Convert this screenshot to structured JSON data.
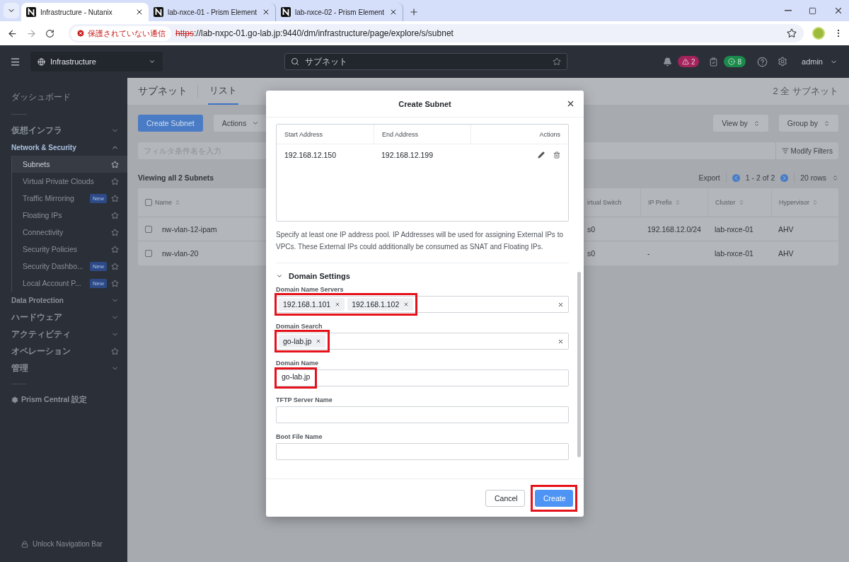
{
  "browser": {
    "tabs": [
      {
        "title": "Infrastructure - Nutanix",
        "selected": true
      },
      {
        "title": "lab-nxce-01 - Prism Element",
        "selected": false
      },
      {
        "title": "lab-nxce-02 - Prism Element",
        "selected": false
      }
    ],
    "security_label": "保護されていない通信",
    "url_scheme": "https",
    "url_rest": "://lab-nxpc-01.go-lab.jp:9440/dm/infrastructure/page/explore/s/subnet"
  },
  "header": {
    "app": "Infrastructure",
    "search": "サブネット",
    "alerts": "2",
    "tasks": "8",
    "user": "admin"
  },
  "sidebar": {
    "home": "ダッシュボード",
    "items": [
      {
        "label": "仮想インフラ",
        "kind": "group",
        "expanded": false
      },
      {
        "label": "Network & Security",
        "kind": "group",
        "expanded": true,
        "children": [
          {
            "label": "Subnets",
            "selected": true
          },
          {
            "label": "Virtual Private Clouds",
            "selected": false
          },
          {
            "label": "Traffic Mirroring",
            "badge": "New",
            "selected": false
          },
          {
            "label": "Floating IPs",
            "selected": false
          },
          {
            "label": "Connectivity",
            "selected": false
          },
          {
            "label": "Security Policies",
            "selected": false
          },
          {
            "label": "Security Dashbo...",
            "badge": "New",
            "selected": false
          },
          {
            "label": "Local Account P...",
            "badge": "New",
            "selected": false
          }
        ]
      },
      {
        "label": "Data Protection",
        "kind": "group",
        "expanded": false
      },
      {
        "label": "ハードウェア",
        "kind": "group",
        "expanded": false
      },
      {
        "label": "アクティビティ",
        "kind": "group",
        "expanded": false
      },
      {
        "label": "オペレーション",
        "kind": "favorite"
      },
      {
        "label": "管理",
        "kind": "group",
        "expanded": false
      }
    ],
    "settings": "Prism Central 設定",
    "unlock": "Unlock Navigation Bar"
  },
  "content": {
    "title": "サブネット",
    "tabs": [
      {
        "label": "リスト",
        "selected": true
      }
    ],
    "summary": "2 全 サブネット",
    "actions": [
      {
        "label": "Create Subnet",
        "kind": "primary"
      },
      {
        "label": "Actions",
        "kind": "menu"
      }
    ],
    "view_buttons": [
      "View by",
      "Group by"
    ],
    "filter": {
      "placeholder": "フィルタ条件名を入力",
      "action": "Modify Filters"
    },
    "viewing": "Viewing all 2 Subnets",
    "export": "Export",
    "pagination": "1 - 2 of 2",
    "rows_per_page": "20 rows",
    "table": {
      "all_checked": false,
      "columns": [
        "Name",
        "irtual Switch",
        "IP Prefix",
        "Cluster",
        "Hypervisor"
      ],
      "rows": [
        {
          "checked": false,
          "cells": [
            "nw-vlan-12-ipam",
            "s0",
            "192.168.12.0/24",
            "lab-nxce-01",
            "AHV"
          ]
        },
        {
          "checked": false,
          "cells": [
            "nw-vlan-20",
            "s0",
            "-",
            "lab-nxce-01",
            "AHV"
          ]
        }
      ]
    }
  },
  "dialog": {
    "title": "Create Subnet",
    "pool_table": {
      "columns": [
        "Start Address",
        "End Address",
        "Actions"
      ],
      "rows": [
        {
          "start": "192.168.12.150",
          "end": "192.168.12.199"
        }
      ]
    },
    "help": "Specify at least one IP address pool. IP Addresses will be used for assigning External IPs to VPCs. These External IPs could additionally be consumed as SNAT and Floating IPs.",
    "section": {
      "title": "Domain Settings",
      "expanded": true
    },
    "fields": [
      {
        "label": "Domain Name Servers",
        "kind": "tags",
        "tags": [
          "192.168.1.101",
          "192.168.1.102"
        ],
        "highlighted": true
      },
      {
        "label": "Domain Search",
        "kind": "tags",
        "tags": [
          "go-lab.jp"
        ],
        "highlighted": true
      },
      {
        "label": "Domain Name",
        "kind": "text",
        "value": "go-lab.jp",
        "highlighted": true
      },
      {
        "label": "TFTP Server Name",
        "kind": "text",
        "highlighted": false
      },
      {
        "label": "Boot File Name",
        "kind": "text",
        "highlighted": false
      }
    ],
    "buttons": [
      {
        "label": "Cancel",
        "kind": "secondary",
        "highlighted": false
      },
      {
        "label": "Create",
        "kind": "primary",
        "highlighted": true
      }
    ]
  }
}
